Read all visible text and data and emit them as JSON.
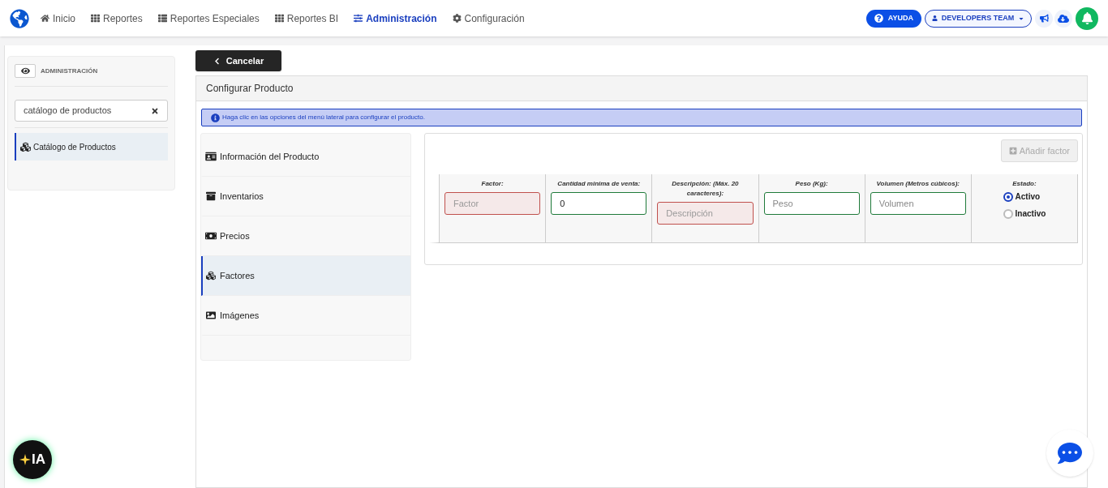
{
  "nav": {
    "items": [
      {
        "label": "Inicio",
        "selected": false
      },
      {
        "label": "Reportes",
        "selected": false
      },
      {
        "label": "Reportes Especiales",
        "selected": false
      },
      {
        "label": "Reportes BI",
        "selected": false
      },
      {
        "label": "Administración",
        "selected": true
      },
      {
        "label": "Configuración",
        "selected": false
      }
    ],
    "help_button": "AYUDA",
    "team_selector": "DEVELOPERS TEAM"
  },
  "sidebar": {
    "title": "ADMINISTRACIÓN",
    "search": {
      "value": "catálogo de productos"
    },
    "items": [
      {
        "label": "Catálogo de Productos",
        "selected": true
      }
    ]
  },
  "cancel_button": "Cancelar",
  "panel": {
    "title": "Configurar Producto",
    "info": "Haga clic en las opciones del menú lateral para configurar el producto.",
    "menu": [
      {
        "label": "Información del Producto",
        "selected": false
      },
      {
        "label": "Inventarios",
        "selected": false
      },
      {
        "label": "Precios",
        "selected": false
      },
      {
        "label": "Factores",
        "selected": true
      },
      {
        "label": "Imágenes",
        "selected": false
      }
    ],
    "add_button": {
      "label": "Añadir factor",
      "disabled": true
    },
    "fields": [
      {
        "kind": "input",
        "label": "Factor:",
        "placeholder": "Factor",
        "valid": false
      },
      {
        "kind": "input",
        "label": "Cantidad minima de venta:",
        "value": "0",
        "valid": true
      },
      {
        "kind": "input",
        "label": "Descripción: (Máx. 20 caracteres):",
        "placeholder": "Descripción",
        "valid": false
      },
      {
        "kind": "input",
        "label": "Peso (Kg):",
        "placeholder": "Peso",
        "valid": true
      },
      {
        "kind": "input",
        "label": "Volumen (Metros cúbicos):",
        "placeholder": "Volumen",
        "valid": true
      },
      {
        "kind": "radio",
        "label": "Estado:",
        "options": [
          {
            "label": "Activo",
            "selected": true
          },
          {
            "label": "Inactivo",
            "selected": false
          }
        ]
      }
    ]
  },
  "ai_button": "IA"
}
